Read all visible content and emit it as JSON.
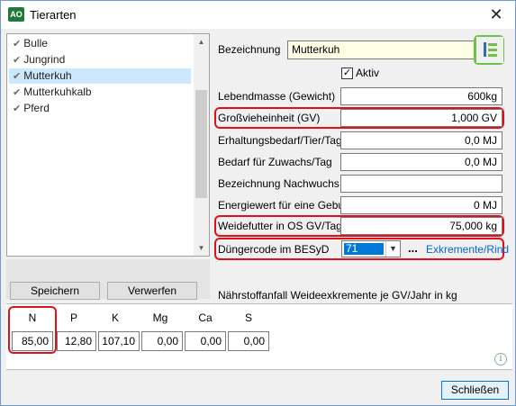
{
  "window": {
    "title": "Tierarten",
    "app_icon": "AO",
    "close_icon": "close-icon"
  },
  "list": {
    "items": [
      {
        "label": "Bulle",
        "selected": false
      },
      {
        "label": "Jungrind",
        "selected": false
      },
      {
        "label": "Mutterkuh",
        "selected": true
      },
      {
        "label": "Mutterkuhkalb",
        "selected": false
      },
      {
        "label": "Pferd",
        "selected": false
      }
    ]
  },
  "buttons": {
    "save": "Speichern",
    "discard": "Verwerfen",
    "close": "Schließen"
  },
  "form": {
    "bezeichnung_label": "Bezeichnung",
    "bezeichnung_value": "Mutterkuh",
    "aktiv_label": "Aktiv",
    "aktiv_checked": true,
    "rows": [
      {
        "label": "Lebendmasse (Gewicht)",
        "value": "600kg"
      },
      {
        "label": "Großvieheinheit (GV)",
        "value": "1,000 GV"
      },
      {
        "label": "Erhaltungsbedarf/Tier/Tag",
        "value": "0,0 MJ"
      },
      {
        "label": "Bedarf für Zuwachs/Tag",
        "value": "0,0 MJ"
      },
      {
        "label": "Bezeichnung Nachwuchs",
        "value": ""
      },
      {
        "label": "Energiewert für eine Geburt",
        "value": "0 MJ"
      },
      {
        "label": "Weidefutter in OS GV/Tag",
        "value": "75,000 kg"
      }
    ],
    "duengercode_label": "Düngercode im BESyD",
    "duengercode_value": "71",
    "ellipsis": "...",
    "duengercode_link": "Exkremente/Rind"
  },
  "nutrients": {
    "section_label": "Nährstoffanfall Weideexkremente je GV/Jahr in kg",
    "items": [
      {
        "name": "N",
        "value": "85,00"
      },
      {
        "name": "P",
        "value": "12,80"
      },
      {
        "name": "K",
        "value": "107,10"
      },
      {
        "name": "Mg",
        "value": "0,00"
      },
      {
        "name": "Ca",
        "value": "0,00"
      },
      {
        "name": "S",
        "value": "0,00"
      }
    ],
    "info_icon": "info-icon"
  },
  "colors": {
    "highlight_red": "#e0101a",
    "highlight_green": "#6cc24a",
    "selection": "#cce8ff",
    "link": "#0066cc"
  }
}
